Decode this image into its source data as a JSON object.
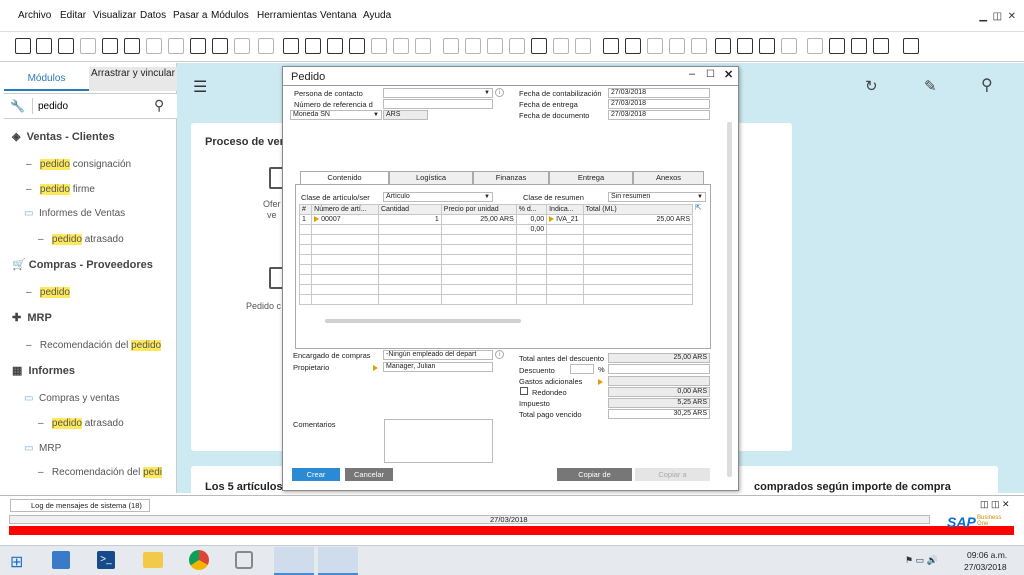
{
  "menu": [
    "Archivo",
    "Editar",
    "Visualizar",
    "Datos",
    "Pasar a",
    "Módulos",
    "Herramientas",
    "Ventana",
    "Ayuda"
  ],
  "sidebar": {
    "tab_modules": "Módulos",
    "tab_drag": "Arrastrar y vincular",
    "search_value": "pedido",
    "sales_head": "Ventas - Clientes",
    "s1_hl": "pedido",
    "s1_rest": " consignación",
    "s2_hl": "pedido",
    "s2_rest": " firme",
    "s3": "Informes de Ventas",
    "s4_hl": "pedido",
    "s4_rest": " atrasado",
    "purch_head": "Compras - Proveedores",
    "p1_hl": "pedido",
    "mrp_head": "MRP",
    "m1": "Recomendación del ",
    "m1_hl": "pedido",
    "rep_head": "Informes",
    "r1": "Compras y ventas",
    "r2_hl": "pedido",
    "r2_rest": " atrasado",
    "r3": "MRP",
    "r4": "Recomendación del ",
    "r4_hl": "pedi"
  },
  "main": {
    "proc_title": "Proceso de ven",
    "ofer": "Ofer",
    "ver": "ve",
    "pedido_c": "Pedido c",
    "bottom_left": "Los 5 artículos",
    "bottom_right": "comprados según importe de compra"
  },
  "dialog": {
    "title": "Pedido",
    "persona_contacto": "Persona de contacto",
    "num_ref": "Número de referencia d",
    "moneda_sn": "Moneda SN",
    "moneda_val": "ARS",
    "fecha_cont_l": "Fecha de contabilización",
    "fecha_cont": "27/03/2018",
    "fecha_ent_l": "Fecha de entrega",
    "fecha_ent": "27/03/2018",
    "fecha_doc_l": "Fecha de documento",
    "fecha_doc": "27/03/2018",
    "tabs": [
      "Contenido",
      "Logística",
      "Finanzas",
      "Entrega",
      "Anexos"
    ],
    "clase_art_l": "Clase de artículo/ser",
    "clase_art": "Artículo",
    "clase_res_l": "Clase de resumen",
    "clase_res": "Sin resumen",
    "cols": [
      "#",
      "Número de artí...",
      "Cantidad",
      "Precio por unidad",
      "% d...",
      "Indica...",
      "Total (ML)"
    ],
    "row1": [
      "1",
      "00007",
      "1",
      "25,00 ARS",
      "0,00",
      "IVA_21",
      "25,00 ARS"
    ],
    "row2_disc": "0,00",
    "encargado_l": "Encargado de compras",
    "encargado": "-Ningún empleado del depart",
    "propietario_l": "Propietario",
    "propietario": "Manager, Julian",
    "comentarios_l": "Comentarios",
    "total_antes_l": "Total antes del descuento",
    "total_antes": "25,00 ARS",
    "descuento_l": "Descuento",
    "pct": "%",
    "gastos_l": "Gastos adicionales",
    "redondeo_l": "Redondeo",
    "redondeo": "0,00 ARS",
    "impuesto_l": "Impuesto",
    "impuesto": "5,25 ARS",
    "total_pago_l": "Total pago vencido",
    "total_pago": "30,25 ARS",
    "btn_crear": "Crear",
    "btn_cancelar": "Cancelar",
    "btn_copiar_de": "Copiar de",
    "btn_copiar_a": "Copiar a"
  },
  "status": {
    "log": "Log de mensajes de sistema (18)",
    "date": "27/03/2018",
    "brand": "SAP",
    "brand_sub": "Business One"
  },
  "taskbar": {
    "time": "09:06 a.m.",
    "date": "27/03/2018"
  },
  "colors": {
    "accent": "#2a7ab9",
    "main_bg": "#cdeaf3",
    "error_bar": "#ff0000",
    "highlight": "#ffe95a"
  }
}
